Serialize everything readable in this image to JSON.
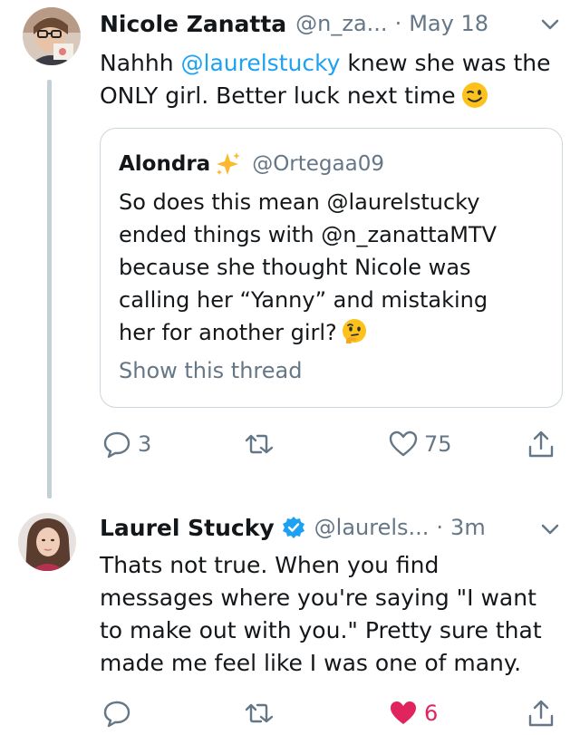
{
  "tweet1": {
    "name": "Nicole Zanatta",
    "handle": "@n_za...",
    "separator": "·",
    "time": "May 18",
    "text_before": "Nahhh ",
    "mention": "@laurelstucky",
    "text_after_line1": " knew she was the",
    "text_line2": "ONLY girl.  Better luck next time",
    "emoji": "wink-emoji",
    "quote": {
      "name": "Alondra",
      "emoji": "sparkles-emoji",
      "handle": "@Ortegaa09",
      "lines": [
        "So does this mean @laurelstucky",
        "ended things with @n_zanattaMTV",
        "because she thought Nicole was",
        "calling her “Yanny” and mistaking",
        "her for another girl?"
      ],
      "end_emoji": "thinking-face-emoji",
      "show_thread": "Show this thread"
    },
    "actions": {
      "reply_count": "3",
      "retweet_count": "",
      "like_count": "75"
    }
  },
  "tweet2": {
    "name": "Laurel Stucky",
    "verified": true,
    "handle": "@laurels...",
    "separator": "·",
    "time": "3m",
    "lines": [
      "Thats not true. When you find",
      "messages where you're saying \"I want",
      "to make out with you.\" Pretty sure that",
      "made me feel like I was one of many."
    ],
    "actions": {
      "reply_count": "",
      "retweet_count": "",
      "like_count": "6",
      "liked": true
    }
  },
  "colors": {
    "link": "#1da1f2",
    "secondary_text": "#657786",
    "like_red": "#e0245e",
    "thread_line": "#c4cfd6"
  }
}
